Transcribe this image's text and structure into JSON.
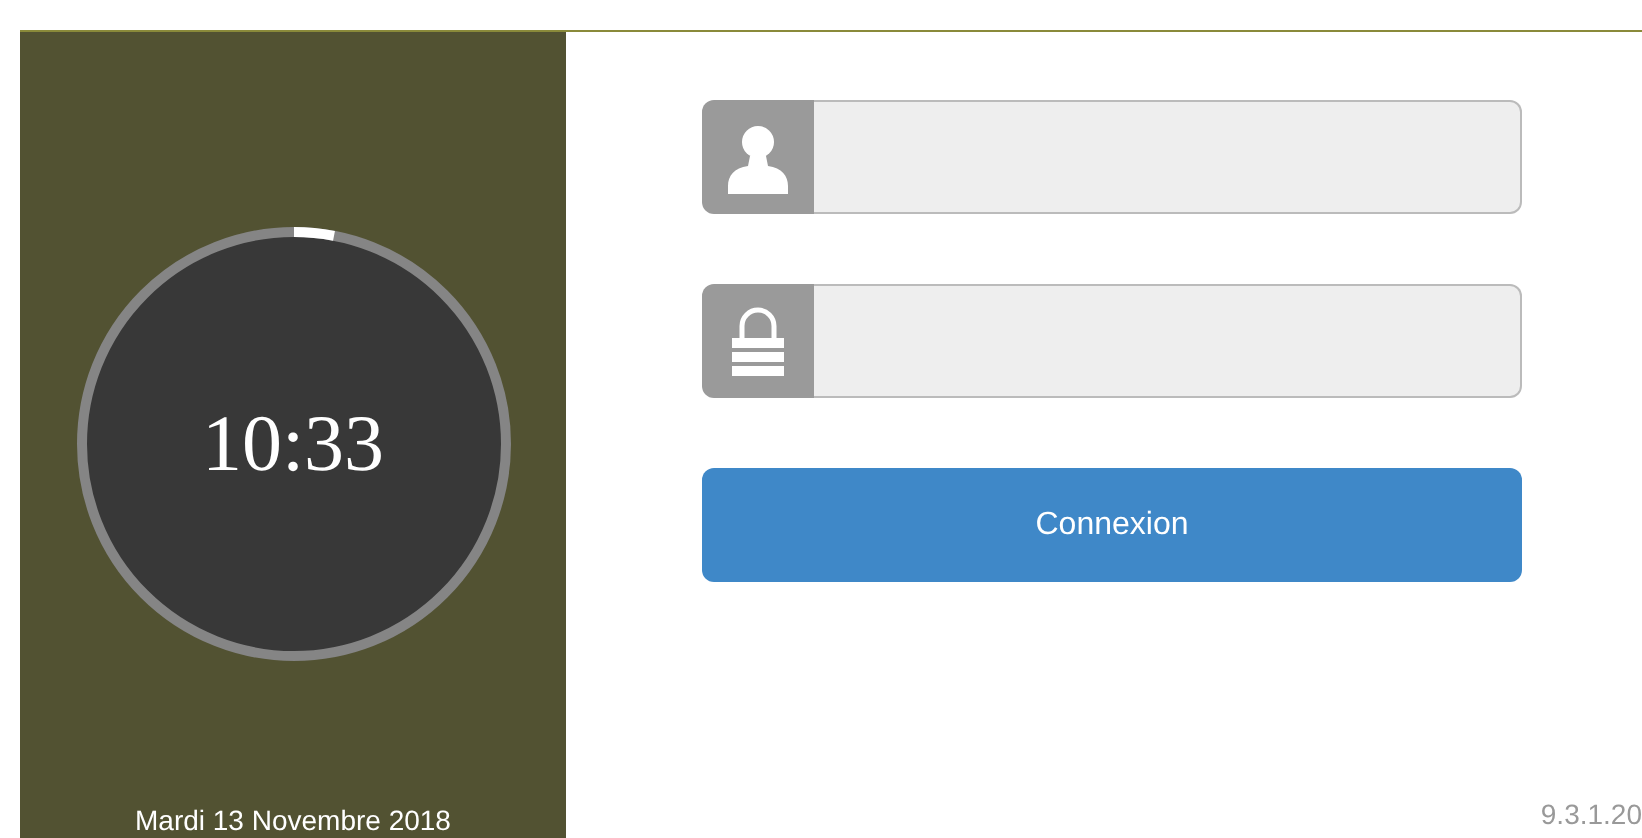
{
  "clock": {
    "time": "10:33"
  },
  "date": "Mardi 13 Novembre 2018",
  "fields": [
    {
      "kind": "user"
    },
    {
      "kind": "password"
    }
  ],
  "login_button": "Connexion",
  "version": "9.3.1.20"
}
